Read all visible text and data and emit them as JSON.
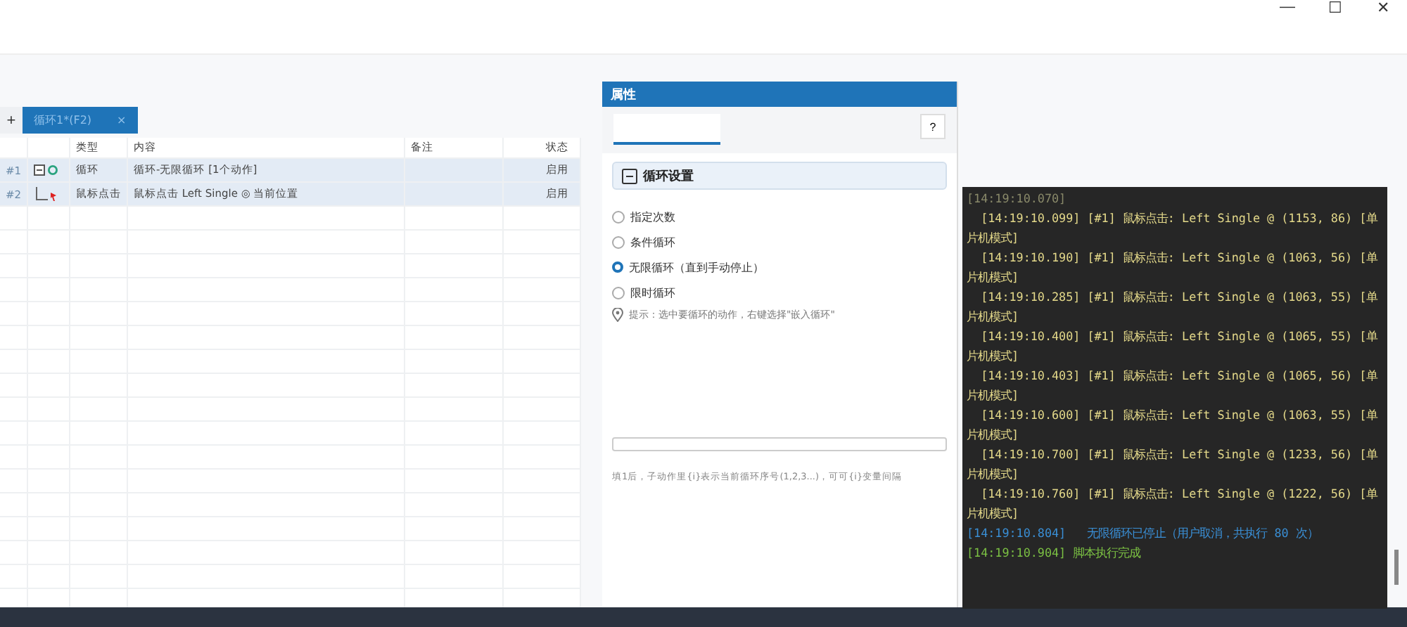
{
  "window": {
    "controls": [
      "—",
      "☐",
      "✕"
    ]
  },
  "editor_tabs": [
    {
      "label": "循环1*(F2)",
      "selected": true,
      "close": "×"
    }
  ],
  "add_tab": "+",
  "table": {
    "columns": [
      "类型",
      "内容",
      "备注",
      "状态"
    ],
    "rows": [
      {
        "index": "#1",
        "kind": "loop",
        "type": "循环",
        "content": "循环-无限循环 [1个动作]",
        "note": "",
        "status": "启用",
        "selected": true
      },
      {
        "index": "#2",
        "kind": "child",
        "type": "鼠标点击",
        "content": "鼠标点击 Left Single ◎ 当前位置",
        "note": "",
        "status": "启用",
        "selected": true
      }
    ]
  },
  "properties": {
    "title": "属性",
    "help": "?",
    "section": "循环设置",
    "options": [
      {
        "label": "指定次数",
        "selected": false
      },
      {
        "label": "条件循环",
        "selected": false
      },
      {
        "label": "无限循环（直到手动停止）",
        "selected": true
      },
      {
        "label": "限时循环",
        "selected": false
      }
    ],
    "hint": "提示：选中要循环的动作，右键选择\"嵌入循环\"",
    "footer": "填1后，子动作里{i}表示当前循环序号(1,2,3...)，可可{i}变量间隔"
  },
  "log": [
    {
      "kind": "plain",
      "text": "[14:19:10.070]"
    },
    {
      "kind": "entry",
      "text": "  [14:19:10.099] [#1] 鼠标点击: Left Single @ (1153, 86) [单片机模式]"
    },
    {
      "kind": "entry",
      "text": "  [14:19:10.190] [#1] 鼠标点击: Left Single @ (1063, 56) [单片机模式]"
    },
    {
      "kind": "entry",
      "text": "  [14:19:10.285] [#1] 鼠标点击: Left Single @ (1063, 55) [单片机模式]"
    },
    {
      "kind": "entry",
      "text": "  [14:19:10.400] [#1] 鼠标点击: Left Single @ (1065, 55) [单片机模式]"
    },
    {
      "kind": "entry",
      "text": "  [14:19:10.403] [#1] 鼠标点击: Left Single @ (1065, 56) [单片机模式]"
    },
    {
      "kind": "entry",
      "text": "  [14:19:10.600] [#1] 鼠标点击: Left Single @ (1063, 55) [单片机模式]"
    },
    {
      "kind": "entry",
      "text": "  [14:19:10.700] [#1] 鼠标点击: Left Single @ (1233, 56) [单片机模式]"
    },
    {
      "kind": "entry",
      "text": "  [14:19:10.760] [#1] 鼠标点击: Left Single @ (1222, 56) [单片机模式]"
    },
    {
      "kind": "info",
      "text": "[14:19:10.804]   无限循环已停止（用户取消，共执行 80 次）"
    },
    {
      "kind": "success",
      "text": "[14:19:10.904] 脚本执行完成"
    }
  ]
}
